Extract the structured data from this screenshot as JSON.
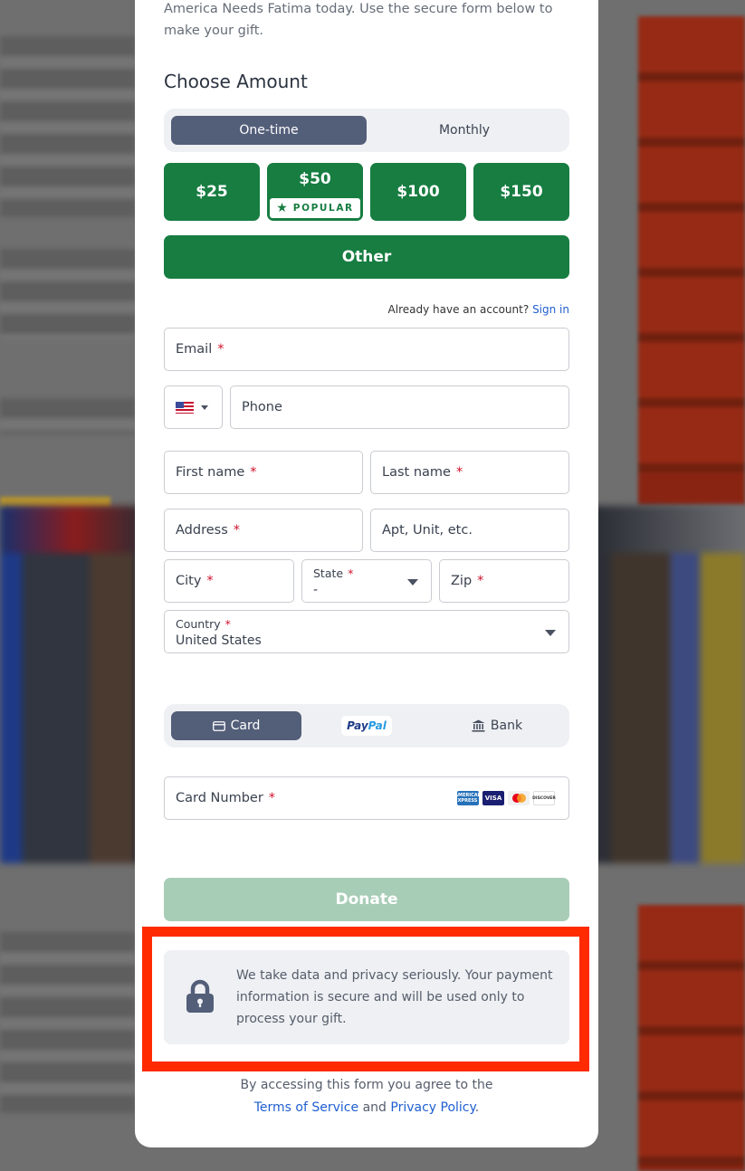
{
  "intro": {
    "line1": "America Needs Fatima today. Use the secure form below to",
    "line2": "make your gift."
  },
  "amount": {
    "title": "Choose Amount",
    "frequency": [
      "One-time",
      "Monthly"
    ],
    "selected_frequency": "One-time",
    "options": [
      "$25",
      "$50",
      "$100",
      "$150"
    ],
    "popular_label": "POPULAR",
    "other_label": "Other"
  },
  "account": {
    "prompt": "Already have an account?",
    "sign_in": "Sign in"
  },
  "form": {
    "email": "Email",
    "phone": "Phone",
    "first_name": "First name",
    "last_name": "Last name",
    "address": "Address",
    "apt": "Apt, Unit, etc.",
    "city": "City",
    "state_label": "State",
    "state_value": "-",
    "zip": "Zip",
    "country_label": "Country",
    "country_value": "United States",
    "required_mark": "*"
  },
  "payment": {
    "card_label": "Card",
    "paypal_1": "Pay",
    "paypal_2": "Pal",
    "bank_label": "Bank",
    "card_number": "Card Number",
    "brands": [
      "AMERICAN EXPRESS",
      "VISA",
      "mastercard",
      "DISCOVER"
    ]
  },
  "donate_label": "Donate",
  "privacy": {
    "line1": "We take data and privacy seriously. Your payment",
    "line2": "information is secure and will be used only to",
    "line3": "process your gift."
  },
  "legal": {
    "prefix": "By accessing this form you agree to the",
    "terms": "Terms of Service",
    "and": "and",
    "policy": "Privacy Policy",
    "period": "."
  },
  "colors": {
    "primary_green": "#177d41",
    "segment_active": "#535e79",
    "donate_disabled": "#a8cdb7",
    "highlight": "#ff2a00",
    "link": "#1f5fd1"
  }
}
